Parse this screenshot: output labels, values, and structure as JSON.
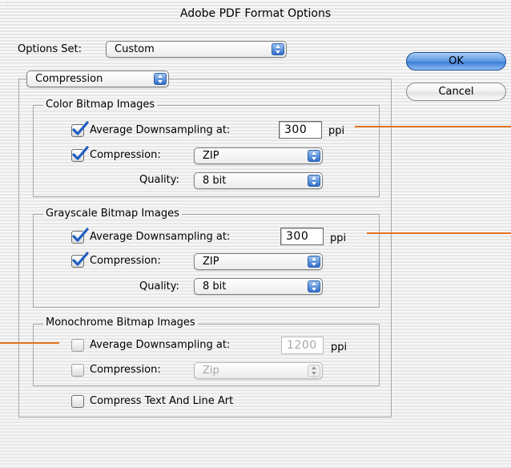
{
  "window": {
    "title": "Adobe PDF Format Options"
  },
  "options_set": {
    "label": "Options Set:",
    "value": "Custom"
  },
  "buttons": {
    "ok": "OK",
    "cancel": "Cancel"
  },
  "panel": {
    "selected": "Compression"
  },
  "color_group": {
    "title": "Color Bitmap Images",
    "downsample_label": "Average Downsampling at:",
    "downsample_checked": true,
    "downsample_value": "300",
    "unit": "ppi",
    "compression_label": "Compression:",
    "compression_checked": true,
    "compression_value": "ZIP",
    "quality_label": "Quality:",
    "quality_value": "8 bit"
  },
  "gray_group": {
    "title": "Grayscale Bitmap Images",
    "downsample_label": "Average Downsampling at:",
    "downsample_checked": true,
    "downsample_value": "300",
    "unit": "ppi",
    "compression_label": "Compression:",
    "compression_checked": true,
    "compression_value": "ZIP",
    "quality_label": "Quality:",
    "quality_value": "8 bit"
  },
  "mono_group": {
    "title": "Monochrome Bitmap Images",
    "downsample_label": "Average Downsampling at:",
    "downsample_checked": false,
    "downsample_value": "1200",
    "unit": "ppi",
    "compression_label": "Compression:",
    "compression_checked": false,
    "compression_value": "Zip"
  },
  "compress_text": {
    "label": "Compress Text And Line Art",
    "checked": false
  },
  "colors": {
    "accent": "#3c7dd6",
    "callout": "#e1731f",
    "check": "#1f5fc4"
  }
}
